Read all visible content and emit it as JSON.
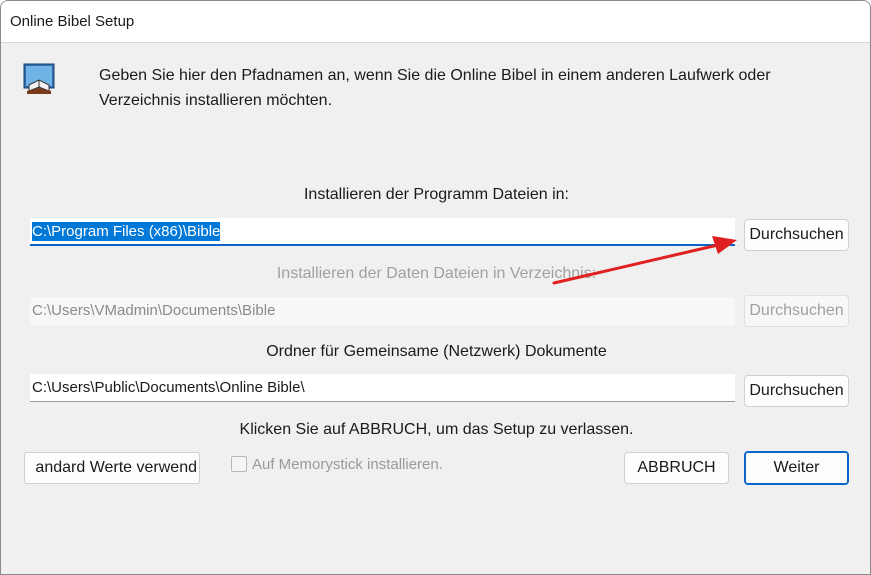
{
  "window": {
    "title": "Online Bibel Setup"
  },
  "intro": {
    "line1": "Geben Sie hier den Pfadnamen an, wenn Sie die Online Bibel in einem anderen Laufwerk oder",
    "line2": "Verzeichnis installieren möchten."
  },
  "program_files": {
    "label": "Installieren der Programm Dateien in:",
    "value": "C:\\Program Files (x86)\\Bible",
    "browse_label": "Durchsuchen"
  },
  "data_files": {
    "label": "Installieren der Daten Dateien in Verzeichnis:",
    "value": "C:\\Users\\VMadmin\\Documents\\Bible",
    "browse_label": "Durchsuchen"
  },
  "shared_docs": {
    "label": "Ordner für Gemeinsame  (Netzwerk) Dokumente",
    "value": "C:\\Users\\Public\\Documents\\Online Bible\\",
    "browse_label": "Durchsuchen"
  },
  "cancel_hint": "Klicken Sie auf ABBRUCH, um das Setup zu verlassen.",
  "buttons": {
    "defaults_label": "andard Werte verwend",
    "cancel_label": "ABBRUCH",
    "next_label": "Weiter"
  },
  "memorystick": {
    "label": "Auf Memorystick installieren.",
    "checked": false
  },
  "colors": {
    "accent": "#0a64c8",
    "selection": "#0078d7",
    "annotation_arrow": "#e02020"
  },
  "icons": [
    "book-icon"
  ]
}
